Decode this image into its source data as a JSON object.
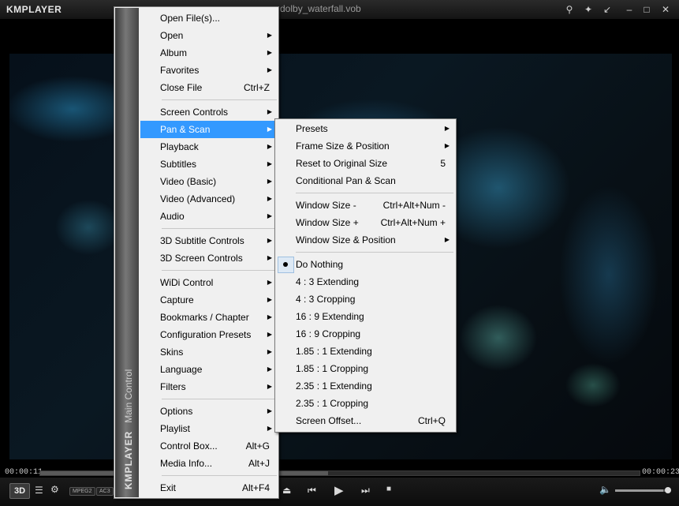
{
  "titlebar": {
    "logo": "KMPLAYER",
    "filename": "dolby_waterfall.vob",
    "buttons": [
      "search-icon",
      "pin-icon",
      "shrink-icon",
      "minimize-icon",
      "maximize-icon",
      "close-icon"
    ]
  },
  "playback": {
    "elapsed": "00:00:11",
    "total": "00:00:23",
    "progress": 0.48,
    "volume": 0.92,
    "badges": [
      "MPEG2",
      "AC3"
    ],
    "btn3d": "3D"
  },
  "main_menu": {
    "sidebar_logo": "KMPLAYER",
    "sidebar_title": "Main Control",
    "items": [
      {
        "label": "Open File(s)...",
        "shortcut": "",
        "submenu": false
      },
      {
        "label": "Open",
        "shortcut": "",
        "submenu": true
      },
      {
        "label": "Album",
        "shortcut": "",
        "submenu": true
      },
      {
        "label": "Favorites",
        "shortcut": "",
        "submenu": true
      },
      {
        "label": "Close File",
        "shortcut": "Ctrl+Z",
        "submenu": false
      },
      {
        "label": "Screen Controls",
        "shortcut": "",
        "submenu": true
      },
      {
        "label": "Pan & Scan",
        "shortcut": "",
        "submenu": true
      },
      {
        "label": "Playback",
        "shortcut": "",
        "submenu": true
      },
      {
        "label": "Subtitles",
        "shortcut": "",
        "submenu": true
      },
      {
        "label": "Video (Basic)",
        "shortcut": "",
        "submenu": true
      },
      {
        "label": "Video (Advanced)",
        "shortcut": "",
        "submenu": true
      },
      {
        "label": "Audio",
        "shortcut": "",
        "submenu": true
      },
      {
        "label": "3D Subtitle Controls",
        "shortcut": "",
        "submenu": true
      },
      {
        "label": "3D Screen Controls",
        "shortcut": "",
        "submenu": true
      },
      {
        "label": "WiDi Control",
        "shortcut": "",
        "submenu": true
      },
      {
        "label": "Capture",
        "shortcut": "",
        "submenu": true
      },
      {
        "label": "Bookmarks / Chapter",
        "shortcut": "",
        "submenu": true
      },
      {
        "label": "Configuration Presets",
        "shortcut": "",
        "submenu": true
      },
      {
        "label": "Skins",
        "shortcut": "",
        "submenu": true
      },
      {
        "label": "Language",
        "shortcut": "",
        "submenu": true
      },
      {
        "label": "Filters",
        "shortcut": "",
        "submenu": true
      },
      {
        "label": "Options",
        "shortcut": "",
        "submenu": true
      },
      {
        "label": "Playlist",
        "shortcut": "",
        "submenu": true
      },
      {
        "label": "Control Box...",
        "shortcut": "Alt+G",
        "submenu": false
      },
      {
        "label": "Media Info...",
        "shortcut": "Alt+J",
        "submenu": false
      },
      {
        "label": "Exit",
        "shortcut": "Alt+F4",
        "submenu": false
      }
    ]
  },
  "pan_scan_menu": {
    "items": [
      {
        "label": "Presets",
        "shortcut": "",
        "submenu": true
      },
      {
        "label": "Frame Size & Position",
        "shortcut": "",
        "submenu": true
      },
      {
        "label": "Reset to Original Size",
        "shortcut": "5",
        "submenu": false
      },
      {
        "label": "Conditional Pan & Scan",
        "shortcut": "",
        "submenu": false
      },
      {
        "label": "Window Size -",
        "shortcut": "Ctrl+Alt+Num -",
        "submenu": false
      },
      {
        "label": "Window Size +",
        "shortcut": "Ctrl+Alt+Num +",
        "submenu": false
      },
      {
        "label": "Window Size & Position",
        "shortcut": "",
        "submenu": true
      },
      {
        "label": "Do Nothing",
        "shortcut": "",
        "submenu": false
      },
      {
        "label": "4 : 3  Extending",
        "shortcut": "",
        "submenu": false
      },
      {
        "label": "4 : 3  Cropping",
        "shortcut": "",
        "submenu": false
      },
      {
        "label": "16 : 9  Extending",
        "shortcut": "",
        "submenu": false
      },
      {
        "label": "16 : 9  Cropping",
        "shortcut": "",
        "submenu": false
      },
      {
        "label": "1.85 : 1  Extending",
        "shortcut": "",
        "submenu": false
      },
      {
        "label": "1.85 : 1  Cropping",
        "shortcut": "",
        "submenu": false
      },
      {
        "label": "2.35 : 1  Extending",
        "shortcut": "",
        "submenu": false
      },
      {
        "label": "2.35 : 1  Cropping",
        "shortcut": "",
        "submenu": false
      },
      {
        "label": "Screen Offset...",
        "shortcut": "Ctrl+Q",
        "submenu": false
      }
    ],
    "selected": "Do Nothing"
  }
}
